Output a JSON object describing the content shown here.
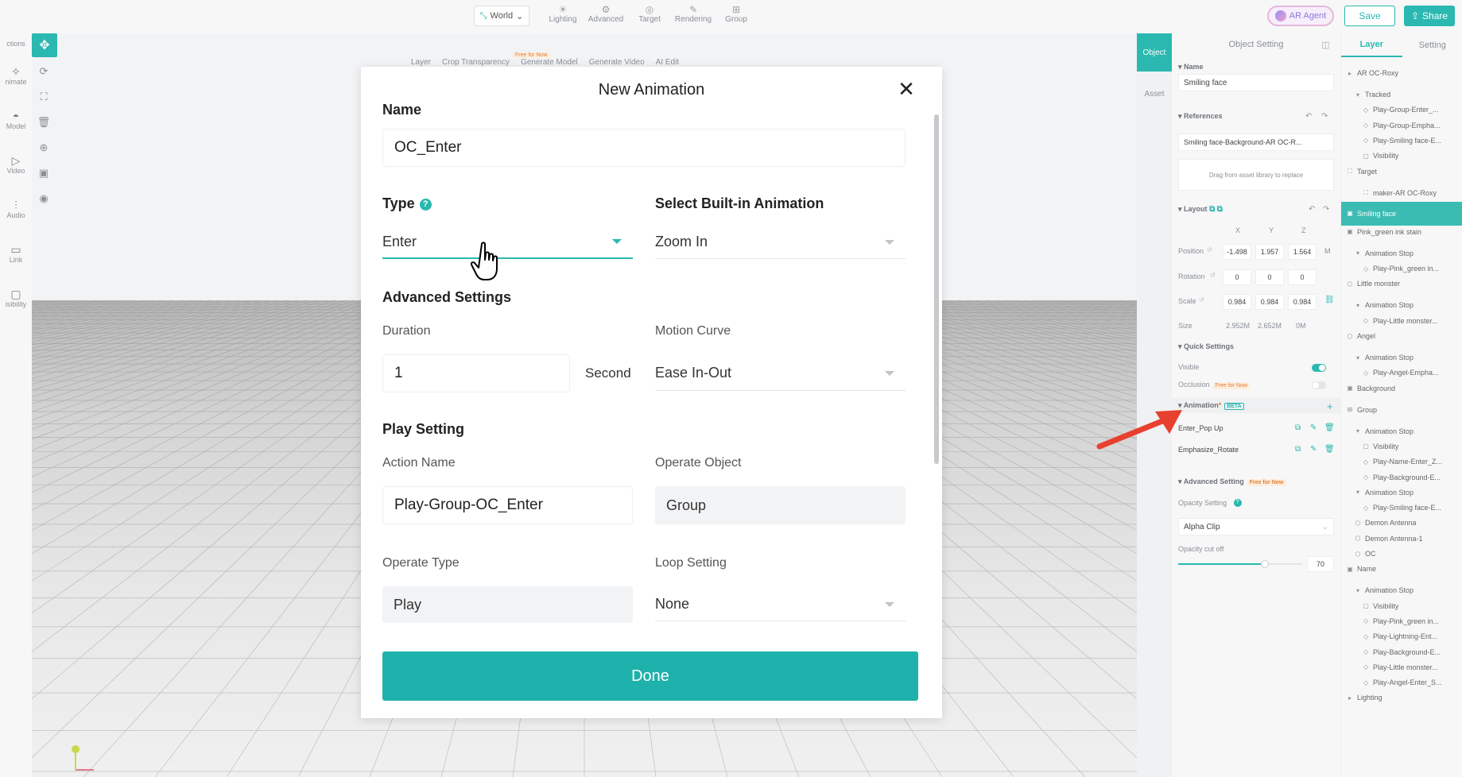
{
  "toolbar": {
    "world": "World",
    "tools": [
      {
        "label": "Lighting"
      },
      {
        "label": "Advanced"
      },
      {
        "label": "Target"
      },
      {
        "label": "Rendering"
      },
      {
        "label": "Group"
      }
    ],
    "ar_agent": "AR Agent",
    "save": "Save",
    "share": "Share"
  },
  "left_sidebar": {
    "items": [
      {
        "label": "ctions"
      },
      {
        "label": "nimate"
      },
      {
        "label": "Model"
      },
      {
        "label": "Video"
      },
      {
        "label": "Audio"
      },
      {
        "label": "Link"
      },
      {
        "label": "isibility"
      }
    ]
  },
  "subtoolbar": {
    "items": [
      "Layer",
      "Crop Transparency",
      "Generate Model",
      "Generate Video",
      "AI Edit"
    ],
    "free_tag": "Free for Now"
  },
  "right_tabs": {
    "object": "Object",
    "asset": "Asset"
  },
  "object_setting": {
    "title": "Object Setting",
    "name_label": "Name",
    "name_value": "Smiling face",
    "references_label": "References",
    "reference_value": "Smiling face-Background-AR OC-R...",
    "drag_hint": "Drag from asset library to replace",
    "layout_label": "Layout",
    "axes": [
      "X",
      "Y",
      "Z"
    ],
    "position_label": "Position",
    "position": [
      "-1.498",
      "1.957",
      "1.564"
    ],
    "position_unit": "M",
    "rotation_label": "Rotation",
    "rotation": [
      "0",
      "0",
      "0"
    ],
    "scale_label": "Scale",
    "scale": [
      "0.984",
      "0.984",
      "0.984"
    ],
    "size_label": "Size",
    "size": [
      "2.952M",
      "2.652M",
      "0M"
    ],
    "quick_settings_label": "Quick Settings",
    "visible_label": "Visible",
    "visible_on": true,
    "occlusion_label": "Occlusion",
    "occlusion_tag": "Free for Now",
    "occlusion_on": false,
    "animation_label": "Animation",
    "animation_tag": "BETA",
    "animations": [
      "Enter_Pop Up",
      "Emphasize_Rotate"
    ],
    "advanced_setting_label": "Advanced Setting",
    "advanced_tag": "Free for Now",
    "opacity_setting_label": "Opacity Setting",
    "opacity_mode": "Alpha Clip",
    "opacity_cutoff_label": "Opacity cut off",
    "opacity_cutoff_value": "70",
    "opacity_cutoff_level": 0.7
  },
  "layers": {
    "tabs": [
      "Layer",
      "Setting"
    ],
    "items": [
      {
        "label": "AR OC-Roxy",
        "indent": 0,
        "icon": "▸"
      },
      {
        "label": "Tracked",
        "indent": 1,
        "icon": "▾"
      },
      {
        "label": "Play-Group-Enter_...",
        "indent": 2,
        "icon": "◇"
      },
      {
        "label": "Play-Group-Empha...",
        "indent": 2,
        "icon": "◇"
      },
      {
        "label": "Play-Smiling face-E...",
        "indent": 2,
        "icon": "◇"
      },
      {
        "label": "Visibility",
        "indent": 2,
        "icon": "▢"
      },
      {
        "label": "Target",
        "indent": 0,
        "icon": "⛶"
      },
      {
        "label": "maker-AR OC-Roxy",
        "indent": 2,
        "icon": "⛶"
      },
      {
        "label": "Smiling face",
        "indent": 0,
        "icon": "▣",
        "selected": true
      },
      {
        "label": "Pink_green ink stain",
        "indent": 0,
        "icon": "▣"
      },
      {
        "label": "Animation Stop",
        "indent": 1,
        "icon": "▾"
      },
      {
        "label": "Play-Pink_green in...",
        "indent": 2,
        "icon": "◇"
      },
      {
        "label": "Little monster",
        "indent": 0,
        "icon": "⬡"
      },
      {
        "label": "Animation Stop",
        "indent": 1,
        "icon": "▾"
      },
      {
        "label": "Play-Little monster...",
        "indent": 2,
        "icon": "◇"
      },
      {
        "label": "Angel",
        "indent": 0,
        "icon": "⬡"
      },
      {
        "label": "Animation Stop",
        "indent": 1,
        "icon": "▾"
      },
      {
        "label": "Play-Angel-Empha...",
        "indent": 2,
        "icon": "◇"
      },
      {
        "label": "Background",
        "indent": 0,
        "icon": "▣"
      },
      {
        "label": "Group",
        "indent": 0,
        "icon": "⊞"
      },
      {
        "label": "Animation Stop",
        "indent": 1,
        "icon": "▾"
      },
      {
        "label": "Visibility",
        "indent": 2,
        "icon": "▢"
      },
      {
        "label": "Play-Name-Enter_Z...",
        "indent": 2,
        "icon": "◇"
      },
      {
        "label": "Play-Background-E...",
        "indent": 2,
        "icon": "◇"
      },
      {
        "label": "Animation Stop",
        "indent": 1,
        "icon": "▾"
      },
      {
        "label": "Play-Smiling face-E...",
        "indent": 2,
        "icon": "◇"
      },
      {
        "label": "Demon Antenna",
        "indent": 1,
        "icon": "⬡"
      },
      {
        "label": "Demon Antenna-1",
        "indent": 1,
        "icon": "⬡"
      },
      {
        "label": "OC",
        "indent": 1,
        "icon": "⬡"
      },
      {
        "label": "Name",
        "indent": 0,
        "icon": "▣"
      },
      {
        "label": "Animation Stop",
        "indent": 1,
        "icon": "▾"
      },
      {
        "label": "Visibility",
        "indent": 2,
        "icon": "▢"
      },
      {
        "label": "Play-Pink_green in...",
        "indent": 2,
        "icon": "◇"
      },
      {
        "label": "Play-Lightning-Ent...",
        "indent": 2,
        "icon": "◇"
      },
      {
        "label": "Play-Background-E...",
        "indent": 2,
        "icon": "◇"
      },
      {
        "label": "Play-Little monster...",
        "indent": 2,
        "icon": "◇"
      },
      {
        "label": "Play-Angel-Enter_S...",
        "indent": 2,
        "icon": "◇"
      },
      {
        "label": "Lighting",
        "indent": 0,
        "icon": "▸"
      }
    ]
  },
  "modal": {
    "title": "New Animation",
    "name_label": "Name",
    "name_value": "OC_Enter",
    "type_label": "Type",
    "type_value": "Enter",
    "builtin_label": "Select Built-in Animation",
    "builtin_value": "Zoom In",
    "advanced_label": "Advanced Settings",
    "duration_label": "Duration",
    "duration_value": "1",
    "duration_unit": "Second",
    "curve_label": "Motion Curve",
    "curve_value": "Ease In-Out",
    "play_setting_label": "Play Setting",
    "action_name_label": "Action Name",
    "action_name_value": "Play-Group-OC_Enter",
    "operate_object_label": "Operate Object",
    "operate_object_value": "Group",
    "operate_type_label": "Operate Type",
    "operate_type_value": "Play",
    "loop_label": "Loop Setting",
    "loop_value": "None",
    "done": "Done"
  },
  "colors": {
    "accent": "#2ab8b0",
    "annotation_arrow": "#e8402f"
  }
}
